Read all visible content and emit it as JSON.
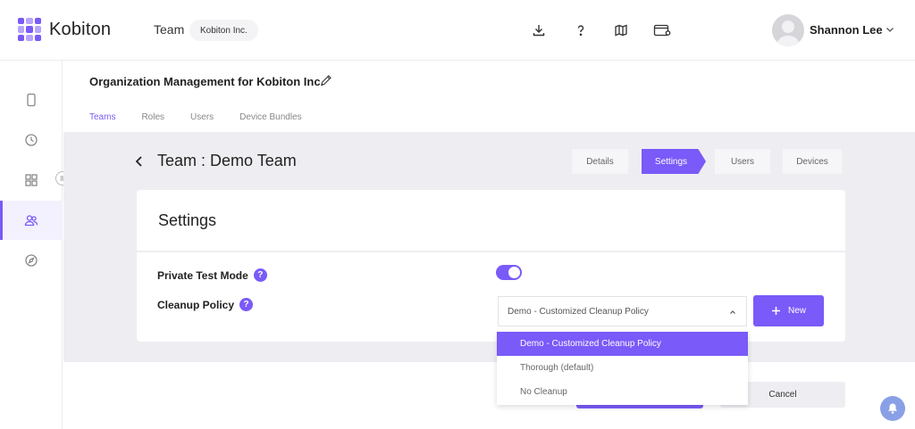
{
  "app": {
    "name": "Kobiton"
  },
  "topbar": {
    "team_label": "Team",
    "team_value": "Kobiton Inc.",
    "icons": [
      "download-icon",
      "help-icon",
      "map-icon",
      "api-icon"
    ],
    "user_name": "Shannon Lee"
  },
  "sidebar": {
    "items": [
      "device-icon",
      "clock-icon",
      "apps-grid-icon",
      "team-icon",
      "compass-icon"
    ],
    "active_index": 3
  },
  "header": {
    "org_title": "Organization Management for Kobiton Inc.",
    "tabs": [
      {
        "label": "Teams",
        "active": true
      },
      {
        "label": "Roles",
        "active": false
      },
      {
        "label": "Users",
        "active": false
      },
      {
        "label": "Device Bundles",
        "active": false
      }
    ]
  },
  "team_page": {
    "title": "Team : Demo Team",
    "steps": [
      {
        "label": "Details"
      },
      {
        "label": "Settings",
        "active": true
      },
      {
        "label": "Users"
      },
      {
        "label": "Devices"
      }
    ]
  },
  "settings": {
    "title": "Settings",
    "private_test_mode_label": "Private Test Mode",
    "private_test_mode_on": true,
    "cleanup_policy_label": "Cleanup Policy",
    "cleanup_policy_value": "Demo - Customized Cleanup Policy",
    "new_button_label": "New",
    "options": [
      {
        "label": "Demo - Customized Cleanup Policy",
        "selected": true
      },
      {
        "label": "Thorough (default)"
      },
      {
        "label": "No Cleanup"
      }
    ]
  },
  "footer": {
    "cancel_label": "Cancel"
  },
  "colors": {
    "accent": "#7a5af8",
    "background": "#eeeef2"
  }
}
